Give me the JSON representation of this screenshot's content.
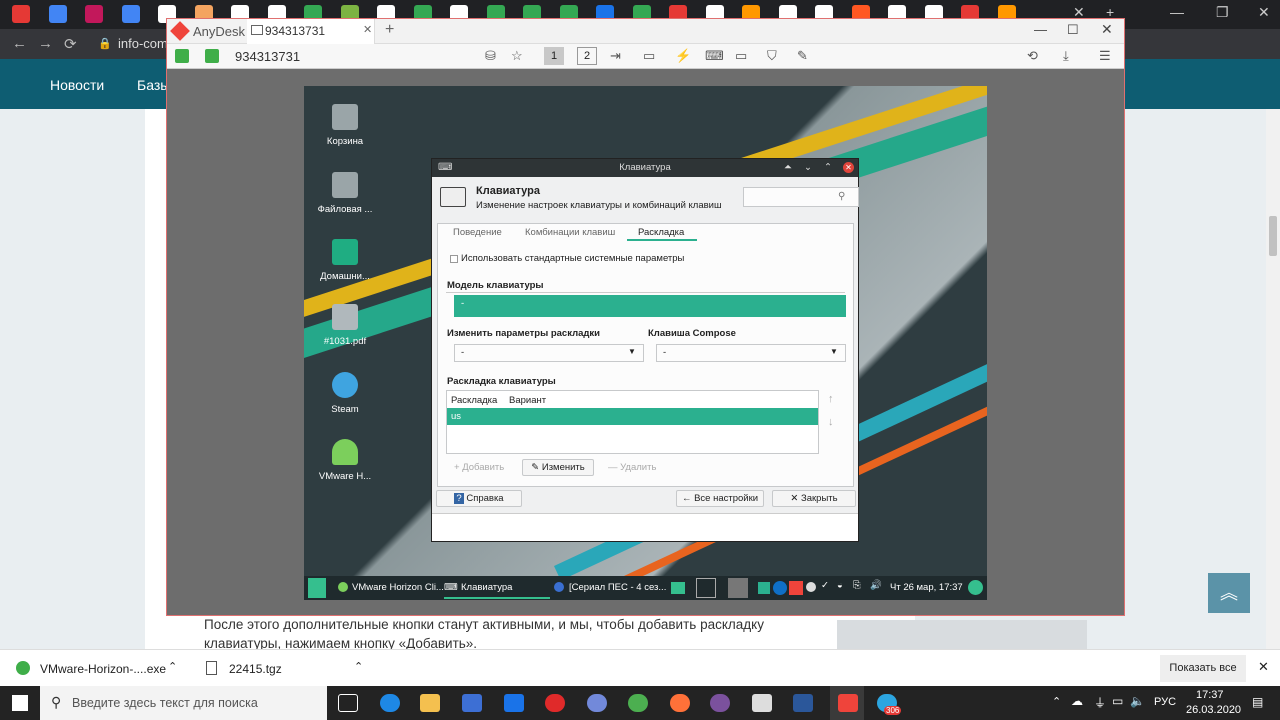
{
  "browser": {
    "url": "info-com",
    "tab_icons_colors": [
      "#e53935",
      "#4285f4",
      "#c2185b",
      "#4285f4",
      "#ffffff",
      "#f4a460",
      "#ffffff",
      "#ffffff",
      "#34a853",
      "#7cb342",
      "#ffffff",
      "#34a853",
      "#ffffff",
      "#34a853",
      "#34a853",
      "#34a853",
      "#1a73e8",
      "#34a853",
      "#e53935",
      "#ffffff",
      "#ff9800",
      "#ffffff",
      "#ffffff",
      "#ff5722",
      "#ffffff",
      "#ffffff",
      "#e53935",
      "#ff9800"
    ],
    "new_tab": "+",
    "close_tab": "✕"
  },
  "site": {
    "nav": [
      "Новости",
      "Базы"
    ],
    "article_text": "После этого дополнительные кнопки станут активными, и мы, чтобы добавить раскладку клавиатуры, нажимаем кнопку «Добавить».",
    "up_icon": "︽"
  },
  "anydesk": {
    "app_name": "AnyDesk",
    "tab_label": "934313731",
    "address": "934313731",
    "monitor1": "1",
    "monitor2": "2"
  },
  "desktop": {
    "icons": [
      {
        "label": "Корзина",
        "icon": "trash-icon",
        "color": "#9aa5a8"
      },
      {
        "label": "Файловая ...",
        "icon": "file-manager-icon",
        "color": "#9aa5a8"
      },
      {
        "label": "Домашни...",
        "icon": "home-folder-icon",
        "color": "#1fad82"
      },
      {
        "label": "#1031.pdf",
        "icon": "pdf-thumbnail-icon",
        "color": "#b0b8bc"
      },
      {
        "label": "Steam",
        "icon": "steam-icon",
        "color": "#3fa4e0"
      },
      {
        "label": "VMware H...",
        "icon": "vmware-icon",
        "color": "#7ccf5c"
      }
    ]
  },
  "dialog": {
    "window_title": "Клавиатура",
    "header_title": "Клавиатура",
    "header_subtitle": "Изменение настроек клавиатуры и комбинаций клавиш",
    "tabs": [
      "Поведение",
      "Комбинации клавиш",
      "Раскладка"
    ],
    "active_tab": "Раскладка",
    "use_system_defaults": "Использовать стандартные системные параметры",
    "keyboard_model_label": "Модель клавиатуры",
    "keyboard_model_value": "-",
    "layout_options_label": "Изменить параметры раскладки",
    "layout_options_value": "-",
    "compose_label": "Клавиша Compose",
    "compose_value": "-",
    "layout_section_label": "Раскладка клавиатуры",
    "columns": [
      "Раскладка",
      "Вариант"
    ],
    "rows": [
      {
        "layout": "us",
        "variant": ""
      }
    ],
    "add": "Добавить",
    "edit": "Изменить",
    "remove": "Удалить",
    "help": "Справка",
    "all_settings": "Все настройки",
    "close": "Закрыть",
    "accent": "#2bb08f"
  },
  "remote_taskbar": {
    "items": [
      "VMware Horizon Cli...",
      "Клавиатура",
      "[Сериал ПЕС - 4 сез..."
    ],
    "clock": "Чт 26 мар, 17:37"
  },
  "downloads": [
    {
      "name": "VMware-Horizon-....exe"
    },
    {
      "name": "22415.tgz"
    }
  ],
  "show_all": "Показать все",
  "taskbar": {
    "search_placeholder": "Введите здесь текст для поиска",
    "lang": "РУС",
    "time": "17:37",
    "date": "26.03.2020",
    "viber_badge": "",
    "telegram_badge": "306"
  }
}
